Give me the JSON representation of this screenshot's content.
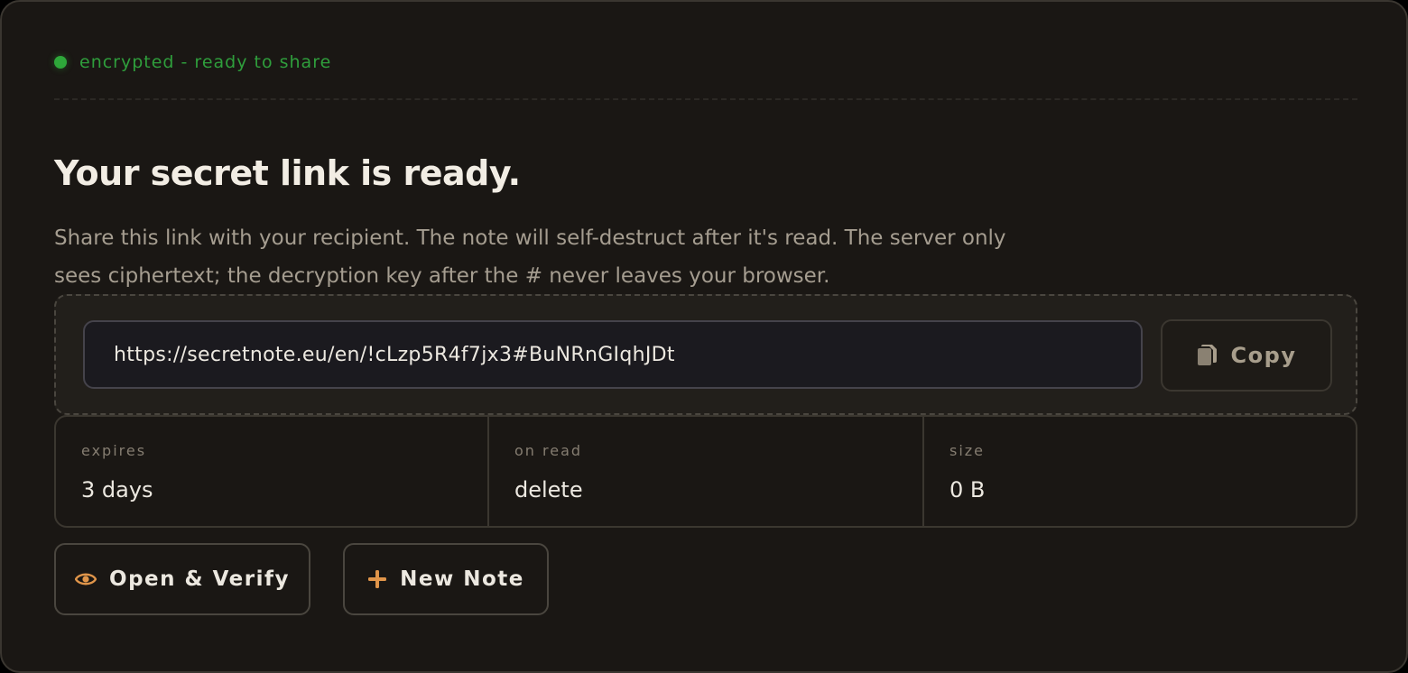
{
  "status": {
    "text": "encrypted - ready to share",
    "color": "#2ea83a"
  },
  "heading": "Your secret link is ready.",
  "description": "Share this link with your recipient. The note will self-destruct after it's read. The server only sees ciphertext; the decryption key after the # never leaves your browser.",
  "link": {
    "url": "https://secretnote.eu/en/!cLzp5R4f7jx3#BuNRnGIqhJDt",
    "copy_label": "Copy",
    "copy_icon": "copy-icon"
  },
  "meta": [
    {
      "label": "expires",
      "value": "3 days"
    },
    {
      "label": "on read",
      "value": "delete"
    },
    {
      "label": "size",
      "value": "0 B"
    }
  ],
  "actions": {
    "verify_label": "Open & Verify",
    "verify_icon": "eye-icon",
    "new_label": "New Note",
    "new_icon": "plus-icon",
    "accent": "#e0954a"
  }
}
